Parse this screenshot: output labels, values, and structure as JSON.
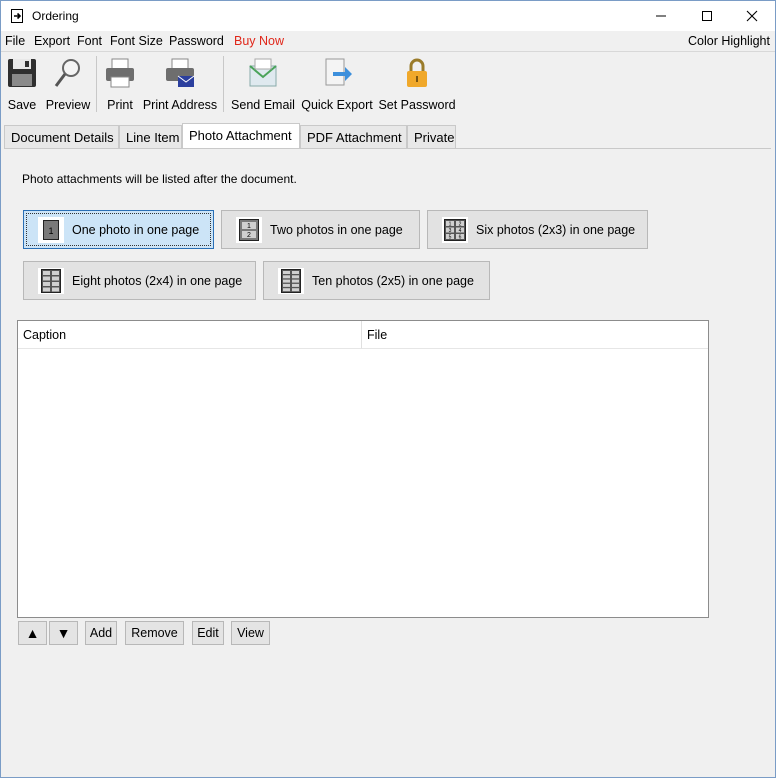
{
  "window": {
    "title": "Ordering"
  },
  "menu": {
    "items": [
      {
        "label": "File"
      },
      {
        "label": "Export"
      },
      {
        "label": "Font"
      },
      {
        "label": "Font Size"
      },
      {
        "label": "Password"
      },
      {
        "label": "Buy Now",
        "color": "#e0271a"
      }
    ],
    "right_label": "Color Highlight"
  },
  "toolbar": {
    "buttons": [
      {
        "label": "Save",
        "icon": "save-icon"
      },
      {
        "label": "Preview",
        "icon": "preview-icon"
      },
      {
        "label": "Print",
        "icon": "printer-icon"
      },
      {
        "label": "Print Address",
        "icon": "print-address-icon"
      },
      {
        "label": "Send Email",
        "icon": "email-icon"
      },
      {
        "label": "Quick Export",
        "icon": "export-icon"
      },
      {
        "label": "Set Password",
        "icon": "lock-icon"
      }
    ]
  },
  "tabs": [
    {
      "label": "Document Details"
    },
    {
      "label": "Line Item"
    },
    {
      "label": "Photo Attachment",
      "active": true
    },
    {
      "label": "PDF Attachment"
    },
    {
      "label": "Private"
    }
  ],
  "photo": {
    "info": "Photo attachments will be listed after the document.",
    "layouts": [
      {
        "label": "One photo in one page",
        "selected": true
      },
      {
        "label": "Two photos in one page"
      },
      {
        "label": "Six photos (2x3) in one page"
      },
      {
        "label": "Eight photos (2x4) in one page"
      },
      {
        "label": "Ten photos (2x5) in one page"
      }
    ],
    "icon_digits": {
      "one": "1",
      "two": [
        "1",
        "2"
      ],
      "six": [
        "1",
        "2",
        "3",
        "4",
        "5",
        "6"
      ]
    },
    "table": {
      "columns": [
        "Caption",
        "File"
      ],
      "rows": []
    },
    "actions": {
      "up": "▲",
      "down": "▼",
      "add": "Add",
      "remove": "Remove",
      "edit": "Edit",
      "view": "View"
    }
  },
  "colors": {
    "selected_bg": "#cce4f7",
    "selected_border": "#2a6fb5",
    "window_border": "#7a9cc6"
  }
}
